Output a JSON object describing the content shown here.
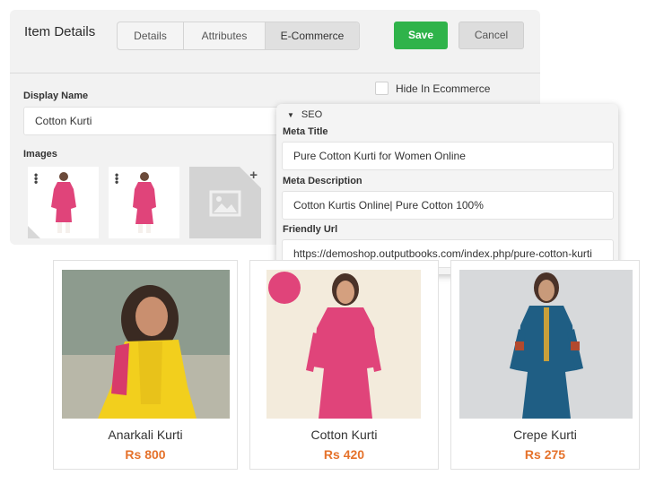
{
  "item_details": {
    "title": "Item Details",
    "tabs": [
      {
        "label": "Details"
      },
      {
        "label": "Attributes"
      },
      {
        "label": "E-Commerce"
      }
    ],
    "active_tab": "E-Commerce",
    "save_label": "Save",
    "cancel_label": "Cancel",
    "display_name_label": "Display Name",
    "display_name_value": "Cotton Kurti",
    "images_label": "Images",
    "hide_in_ecommerce_label": "Hide In Ecommerce",
    "hide_in_ecommerce_checked": false
  },
  "seo": {
    "section_label": "SEO",
    "meta_title_label": "Meta Title",
    "meta_title_value": "Pure Cotton Kurti for Women Online",
    "meta_description_label": "Meta Description",
    "meta_description_value": "Cotton Kurtis Online| Pure Cotton 100%",
    "friendly_url_label": "Friendly Url",
    "friendly_url_value": "https://demoshop.outputbooks.com/index.php/pure-cotton-kurti"
  },
  "products": [
    {
      "name": "Anarkali Kurti",
      "price": "Rs 800"
    },
    {
      "name": "Cotton Kurti",
      "price": "Rs 420"
    },
    {
      "name": "Crepe Kurti",
      "price": "Rs 275"
    }
  ],
  "colors": {
    "save_green": "#2fb34a",
    "price_orange": "#e5722b",
    "pink_kurti": "#e0447a",
    "yellow_kurti": "#f2cf1d",
    "blue_kurti": "#1f5e84"
  }
}
